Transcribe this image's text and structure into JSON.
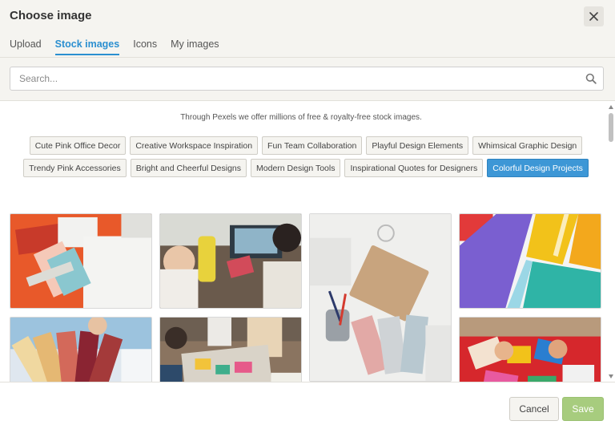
{
  "dialog": {
    "title": "Choose image"
  },
  "tabs": [
    {
      "label": "Upload",
      "active": false
    },
    {
      "label": "Stock images",
      "active": true
    },
    {
      "label": "Icons",
      "active": false
    },
    {
      "label": "My images",
      "active": false
    }
  ],
  "search": {
    "placeholder": "Search...",
    "value": ""
  },
  "info_text": "Through Pexels we offer millions of free & royalty-free stock images.",
  "chips": [
    {
      "label": "Cute Pink Office Decor"
    },
    {
      "label": "Creative Workspace Inspiration"
    },
    {
      "label": "Fun Team Collaboration"
    },
    {
      "label": "Playful Design Elements"
    },
    {
      "label": "Whimsical Graphic Design"
    },
    {
      "label": "Trendy Pink Accessories"
    },
    {
      "label": "Bright and Cheerful Designs"
    },
    {
      "label": "Modern Design Tools"
    },
    {
      "label": "Inspirational Quotes for Designers"
    },
    {
      "label": "Colorful Design Projects",
      "active": true
    }
  ],
  "footer": {
    "cancel_label": "Cancel",
    "save_label": "Save"
  },
  "colors": {
    "accent": "#3d97d6",
    "tab_active": "#2b8fd0",
    "save": "#a7cc7e"
  }
}
